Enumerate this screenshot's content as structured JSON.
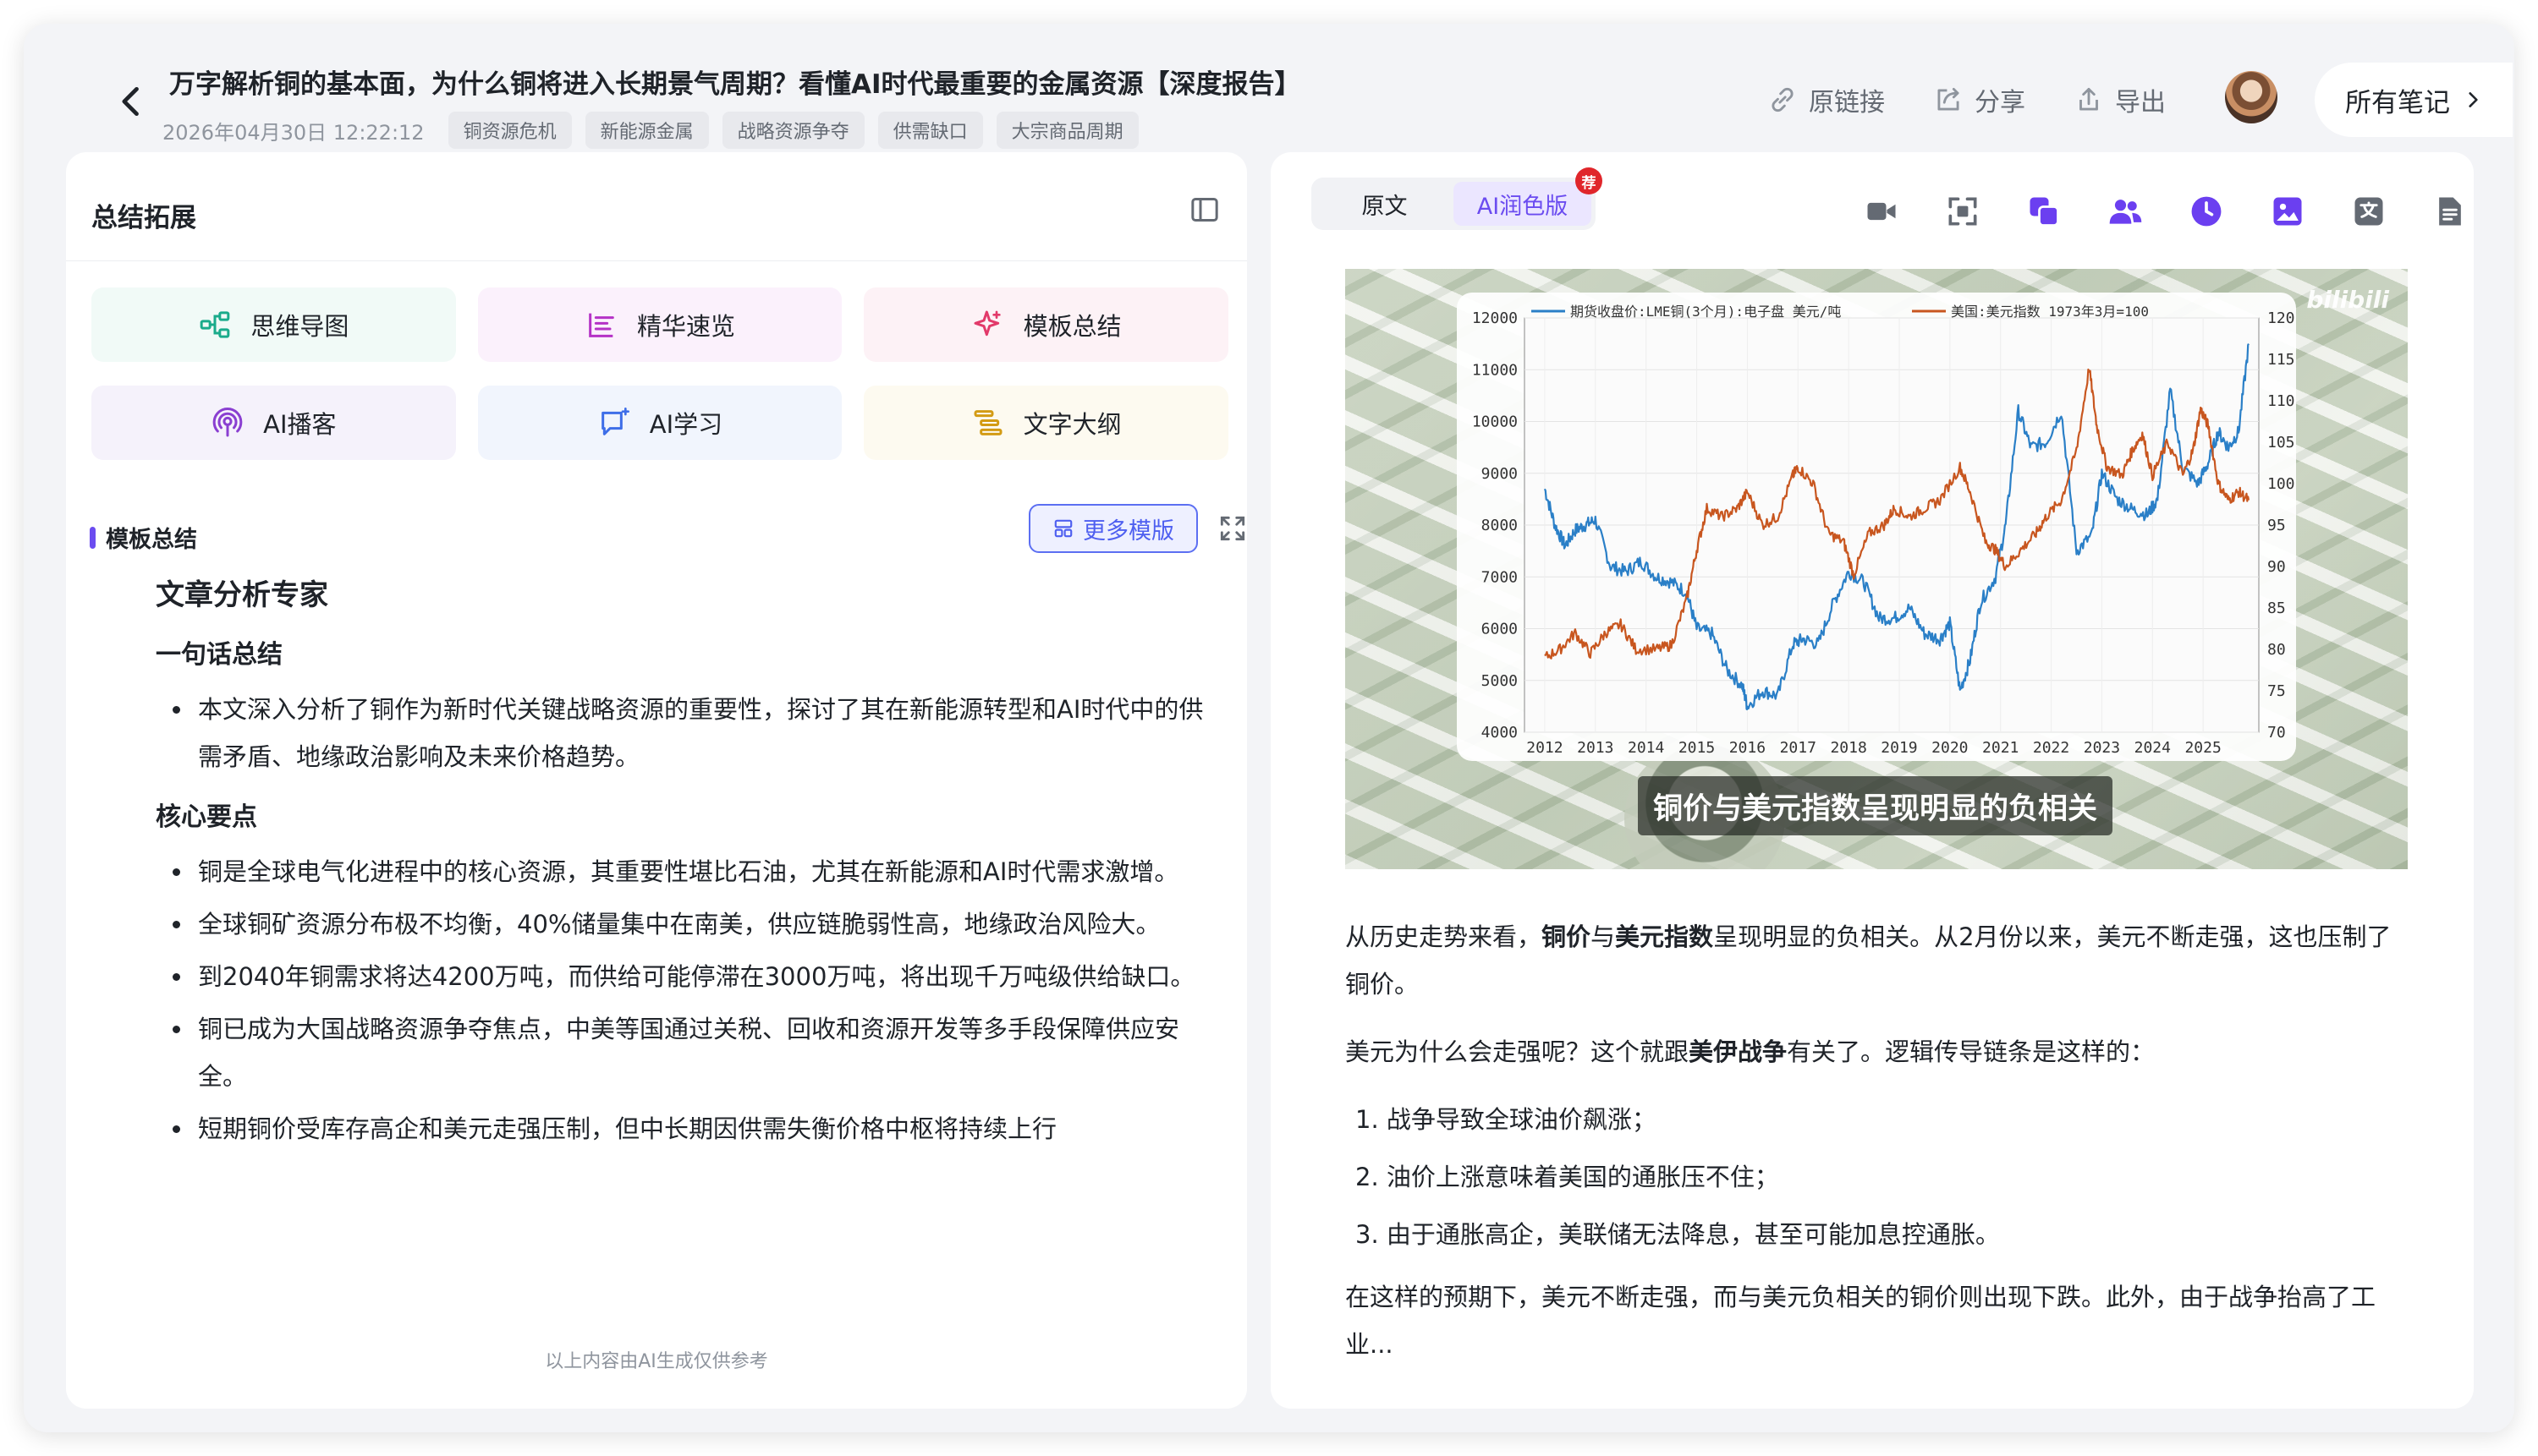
{
  "header": {
    "title": "万字解析铜的基本面，为什么铜将进入长期景气周期？看懂AI时代最重要的金属资源【深度报告】",
    "date": "2026年04月30日 12:22:12",
    "tags": [
      "铜资源危机",
      "新能源金属",
      "战略资源争夺",
      "供需缺口",
      "大宗商品周期"
    ],
    "actions": {
      "source_link": "原链接",
      "share": "分享",
      "export": "导出"
    },
    "all_notes": "所有笔记"
  },
  "left_panel": {
    "title": "总结拓展",
    "features": [
      {
        "label": "思维导图",
        "icon": "mindmap-icon",
        "color": "#1aab8b",
        "bg": "#f1faf7"
      },
      {
        "label": "精华速览",
        "icon": "highlights-icon",
        "color": "#b532c6",
        "bg": "#fbf1fc"
      },
      {
        "label": "模板总结",
        "icon": "sparkle-icon",
        "color": "#e23a6a",
        "bg": "#fdf2f6"
      },
      {
        "label": "AI播客",
        "icon": "podcast-icon",
        "color": "#8a3fd1",
        "bg": "#f5f2fb"
      },
      {
        "label": "AI学习",
        "icon": "ai-learning-icon",
        "color": "#3e6ee8",
        "bg": "#f1f5fd"
      },
      {
        "label": "文字大纲",
        "icon": "outline-icon",
        "color": "#d39b14",
        "bg": "#fdfaf0"
      }
    ],
    "section_label": "模板总结",
    "more_templates": "更多模版",
    "summary": {
      "heading": "文章分析专家",
      "one_sentence_title": "一句话总结",
      "one_sentence": "本文深入分析了铜作为新时代关键战略资源的重要性，探讨了其在新能源转型和AI时代中的供需矛盾、地缘政治影响及未来价格趋势。",
      "key_points_title": "核心要点",
      "key_points": [
        "铜是全球电气化进程中的核心资源，其重要性堪比石油，尤其在新能源和AI时代需求激增。",
        "全球铜矿资源分布极不均衡，40%储量集中在南美，供应链脆弱性高，地缘政治风险大。",
        "到2040年铜需求将达4200万吨，而供给可能停滞在3000万吨，将出现千万吨级供给缺口。",
        "铜已成为大国战略资源争夺焦点，中美等国通过关税、回收和资源开发等多手段保障供应安全。",
        "短期铜价受库存高企和美元走强压制，但中长期因供需失衡价格中枢将持续上行"
      ]
    },
    "disclaimer": "以上内容由AI生成仅供参考"
  },
  "right_panel": {
    "tabs": [
      "原文",
      "AI润色版"
    ],
    "active_tab": 1,
    "badge": "荐",
    "tool_icons": [
      {
        "name": "video-icon",
        "color": "#646a73"
      },
      {
        "name": "screenshot-icon",
        "color": "#646a73"
      },
      {
        "name": "copy-icon",
        "color": "#6b3ff0"
      },
      {
        "name": "users-icon",
        "color": "#6b3ff0"
      },
      {
        "name": "clock-icon",
        "color": "#6b3ff0"
      },
      {
        "name": "image-icon",
        "color": "#6b3ff0"
      },
      {
        "name": "translate-icon",
        "color": "#646a73"
      },
      {
        "name": "document-icon",
        "color": "#646a73"
      }
    ],
    "media": {
      "caption": "铜价与美元指数呈现明显的负相关",
      "watermark": "bilibili"
    },
    "article": {
      "p1_parts": [
        "从历史走势来看，",
        "铜价",
        "与",
        "美元指数",
        "呈现明显的负相关。从2月份以来，美元不断走强，这也压制了铜价。"
      ],
      "p2_parts": [
        "美元为什么会走强呢？这个就跟",
        "美伊战争",
        "有关了。逻辑传导链条是这样的："
      ],
      "steps": [
        "1. 战争导致全球油价飙涨；",
        "2. 油价上涨意味着美国的通胀压不住；",
        "3. 由于通胀高企，美联储无法降息，甚至可能加息控通胀。"
      ],
      "p3": "在这样的预期下，美元不断走强，而与美元负相关的铜价则出现下跌。此外，由于战争抬高了工业..."
    }
  },
  "chart_data": {
    "type": "line",
    "series": [
      {
        "name": "期货收盘价:LME铜(3个月):电子盘 美元/吨",
        "axis": "left",
        "color": "#2a7fc7",
        "points": [
          [
            2012.0,
            8700
          ],
          [
            2012.2,
            8000
          ],
          [
            2012.4,
            7600
          ],
          [
            2012.6,
            7900
          ],
          [
            2012.8,
            8000
          ],
          [
            2013.0,
            8100
          ],
          [
            2013.3,
            7200
          ],
          [
            2013.6,
            7100
          ],
          [
            2013.9,
            7300
          ],
          [
            2014.2,
            7000
          ],
          [
            2014.5,
            6900
          ],
          [
            2014.8,
            6700
          ],
          [
            2015.0,
            6000
          ],
          [
            2015.3,
            5900
          ],
          [
            2015.6,
            5200
          ],
          [
            2015.9,
            4900
          ],
          [
            2016.0,
            4500
          ],
          [
            2016.3,
            4800
          ],
          [
            2016.6,
            4700
          ],
          [
            2016.9,
            5700
          ],
          [
            2017.1,
            5800
          ],
          [
            2017.4,
            5700
          ],
          [
            2017.7,
            6500
          ],
          [
            2018.0,
            7100
          ],
          [
            2018.3,
            6900
          ],
          [
            2018.6,
            6200
          ],
          [
            2018.9,
            6200
          ],
          [
            2019.2,
            6400
          ],
          [
            2019.5,
            5900
          ],
          [
            2019.8,
            5800
          ],
          [
            2020.0,
            6100
          ],
          [
            2020.2,
            4800
          ],
          [
            2020.4,
            5400
          ],
          [
            2020.6,
            6500
          ],
          [
            2020.9,
            7000
          ],
          [
            2021.1,
            8000
          ],
          [
            2021.35,
            10200
          ],
          [
            2021.6,
            9500
          ],
          [
            2021.9,
            9600
          ],
          [
            2022.2,
            10200
          ],
          [
            2022.5,
            7500
          ],
          [
            2022.8,
            7800
          ],
          [
            2023.0,
            9000
          ],
          [
            2023.3,
            8500
          ],
          [
            2023.6,
            8300
          ],
          [
            2023.9,
            8200
          ],
          [
            2024.1,
            8500
          ],
          [
            2024.35,
            10600
          ],
          [
            2024.6,
            9100
          ],
          [
            2024.9,
            8800
          ],
          [
            2025.1,
            9200
          ],
          [
            2025.3,
            9800
          ],
          [
            2025.5,
            9500
          ],
          [
            2025.7,
            9800
          ],
          [
            2025.9,
            11500
          ]
        ]
      },
      {
        "name": "美国:美元指数 1973年3月=100",
        "axis": "right",
        "color": "#c8561f",
        "points": [
          [
            2012.0,
            79
          ],
          [
            2012.3,
            80
          ],
          [
            2012.6,
            82
          ],
          [
            2012.9,
            79.5
          ],
          [
            2013.2,
            82
          ],
          [
            2013.5,
            83
          ],
          [
            2013.8,
            80
          ],
          [
            2014.2,
            80
          ],
          [
            2014.5,
            80.5
          ],
          [
            2014.8,
            86
          ],
          [
            2015.0,
            92
          ],
          [
            2015.2,
            97
          ],
          [
            2015.5,
            96
          ],
          [
            2015.8,
            97
          ],
          [
            2016.0,
            99
          ],
          [
            2016.3,
            95
          ],
          [
            2016.6,
            96
          ],
          [
            2016.9,
            101
          ],
          [
            2017.0,
            102
          ],
          [
            2017.3,
            100
          ],
          [
            2017.6,
            94
          ],
          [
            2017.9,
            93
          ],
          [
            2018.1,
            89
          ],
          [
            2018.4,
            94
          ],
          [
            2018.7,
            95
          ],
          [
            2018.9,
            97
          ],
          [
            2019.2,
            96
          ],
          [
            2019.5,
            97
          ],
          [
            2019.8,
            98
          ],
          [
            2020.2,
            102
          ],
          [
            2020.4,
            99
          ],
          [
            2020.7,
            93
          ],
          [
            2020.9,
            92
          ],
          [
            2021.1,
            90
          ],
          [
            2021.4,
            92
          ],
          [
            2021.7,
            94
          ],
          [
            2021.9,
            96
          ],
          [
            2022.2,
            98
          ],
          [
            2022.5,
            104
          ],
          [
            2022.75,
            114
          ],
          [
            2022.9,
            107
          ],
          [
            2023.1,
            102
          ],
          [
            2023.4,
            101
          ],
          [
            2023.6,
            104
          ],
          [
            2023.8,
            106
          ],
          [
            2024.0,
            101
          ],
          [
            2024.3,
            105
          ],
          [
            2024.6,
            101
          ],
          [
            2024.8,
            104
          ],
          [
            2024.95,
            109
          ],
          [
            2025.1,
            107
          ],
          [
            2025.3,
            100
          ],
          [
            2025.5,
            98
          ],
          [
            2025.7,
            99
          ],
          [
            2025.9,
            98
          ]
        ]
      }
    ],
    "x_ticks": [
      2012,
      2013,
      2014,
      2015,
      2016,
      2017,
      2018,
      2019,
      2020,
      2021,
      2022,
      2023,
      2024,
      2025
    ],
    "y_left_ticks": [
      4000,
      5000,
      6000,
      7000,
      8000,
      9000,
      10000,
      11000,
      12000
    ],
    "y_right_ticks": [
      70,
      75,
      80,
      85,
      90,
      95,
      100,
      105,
      110,
      115,
      120
    ],
    "xlim": [
      2011.6,
      2026.1
    ],
    "ylim_left": [
      4000,
      12000
    ],
    "ylim_right": [
      70,
      120
    ],
    "grid": true,
    "legend": "top"
  }
}
